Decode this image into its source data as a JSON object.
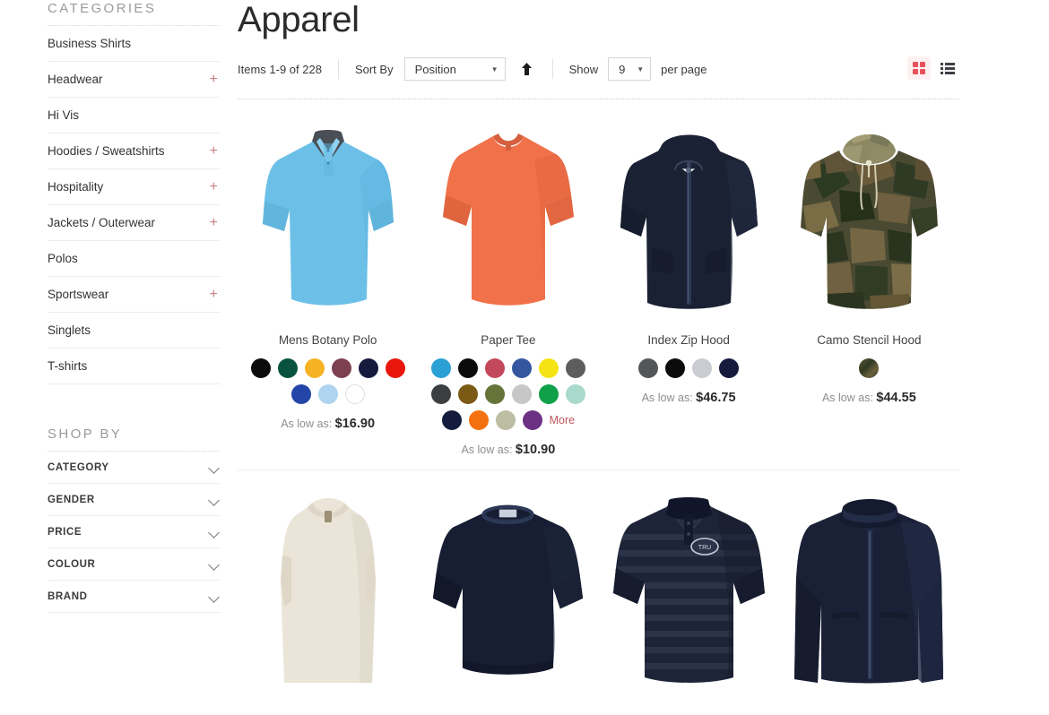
{
  "sidebar": {
    "categories_heading": "CATEGORIES",
    "categories": [
      {
        "label": "Business Shirts",
        "expandable": false
      },
      {
        "label": "Headwear",
        "expandable": true
      },
      {
        "label": "Hi Vis",
        "expandable": false
      },
      {
        "label": "Hoodies / Sweatshirts",
        "expandable": true
      },
      {
        "label": "Hospitality",
        "expandable": true
      },
      {
        "label": "Jackets / Outerwear",
        "expandable": true
      },
      {
        "label": "Polos",
        "expandable": false
      },
      {
        "label": "Sportswear",
        "expandable": true
      },
      {
        "label": "Singlets",
        "expandable": false
      },
      {
        "label": "T-shirts",
        "expandable": false
      }
    ],
    "shopby_heading": "SHOP BY",
    "filters": [
      {
        "label": "CATEGORY"
      },
      {
        "label": "GENDER"
      },
      {
        "label": "PRICE"
      },
      {
        "label": "COLOUR"
      },
      {
        "label": "BRAND"
      }
    ],
    "expand_icon": "plus-icon",
    "collapse_icon": "chevron-down-icon"
  },
  "main": {
    "title": "Apparel",
    "toolbar": {
      "items_count": "Items 1-9 of 228",
      "sort_label": "Sort By",
      "sort_value": "Position",
      "sort_direction_icon": "arrow-up-icon",
      "show_label": "Show",
      "show_value": "9",
      "per_page_label": "per page",
      "view_mode_active": "grid"
    },
    "products": [
      {
        "name": "Mens Botany Polo",
        "price_prefix": "As low as:",
        "price": "$16.90",
        "image": "light-blue-polo-shirt",
        "swatches": [
          "#0b0b0b",
          "#0a5240",
          "#f5b324",
          "#7d4050",
          "#141b3c",
          "#e8160c",
          "#2446a8",
          "#aed4ef",
          "#ffffff"
        ],
        "more": null
      },
      {
        "name": "Paper Tee",
        "price_prefix": "As low as:",
        "price": "$10.90",
        "image": "orange-t-shirt",
        "swatches": [
          "#2ba0d4",
          "#0b0b0b",
          "#c4485b",
          "#33569f",
          "#f5e312",
          "#5d5d5d",
          "#3c3f42",
          "#7b5a16",
          "#66743a",
          "#c7c7c7",
          "#10a04a",
          "#a9d9cb",
          "#141b3c",
          "#f4710f",
          "#bcbda2",
          "#6c3183"
        ],
        "more": "More"
      },
      {
        "name": "Index Zip Hood",
        "price_prefix": "As low as:",
        "price": "$46.75",
        "image": "navy-zip-hoodie",
        "swatches": [
          "#545659",
          "#0b0b0b",
          "#c9ccd1",
          "#141b3c"
        ],
        "more": null
      },
      {
        "name": "Camo Stencil Hood",
        "price_prefix": "As low as:",
        "price": "$44.55",
        "image": "camo-hoodie",
        "swatches": [
          "#4a4532"
        ],
        "more": null
      },
      {
        "name": "",
        "price_prefix": "",
        "price": "",
        "image": "cream-tank-top",
        "swatches": [],
        "more": null
      },
      {
        "name": "",
        "price_prefix": "",
        "price": "",
        "image": "navy-crewneck-sweatshirt",
        "swatches": [],
        "more": null
      },
      {
        "name": "",
        "price_prefix": "",
        "price": "",
        "image": "navy-striped-polo",
        "swatches": [],
        "more": null
      },
      {
        "name": "",
        "price_prefix": "",
        "price": "",
        "image": "navy-rain-jacket",
        "swatches": [],
        "more": null
      }
    ]
  },
  "colors": {
    "accent": "#e8505b",
    "plus": "#c87f86",
    "more_link": "#c0555d",
    "text": "#333333",
    "muted": "#8d8d8d"
  }
}
